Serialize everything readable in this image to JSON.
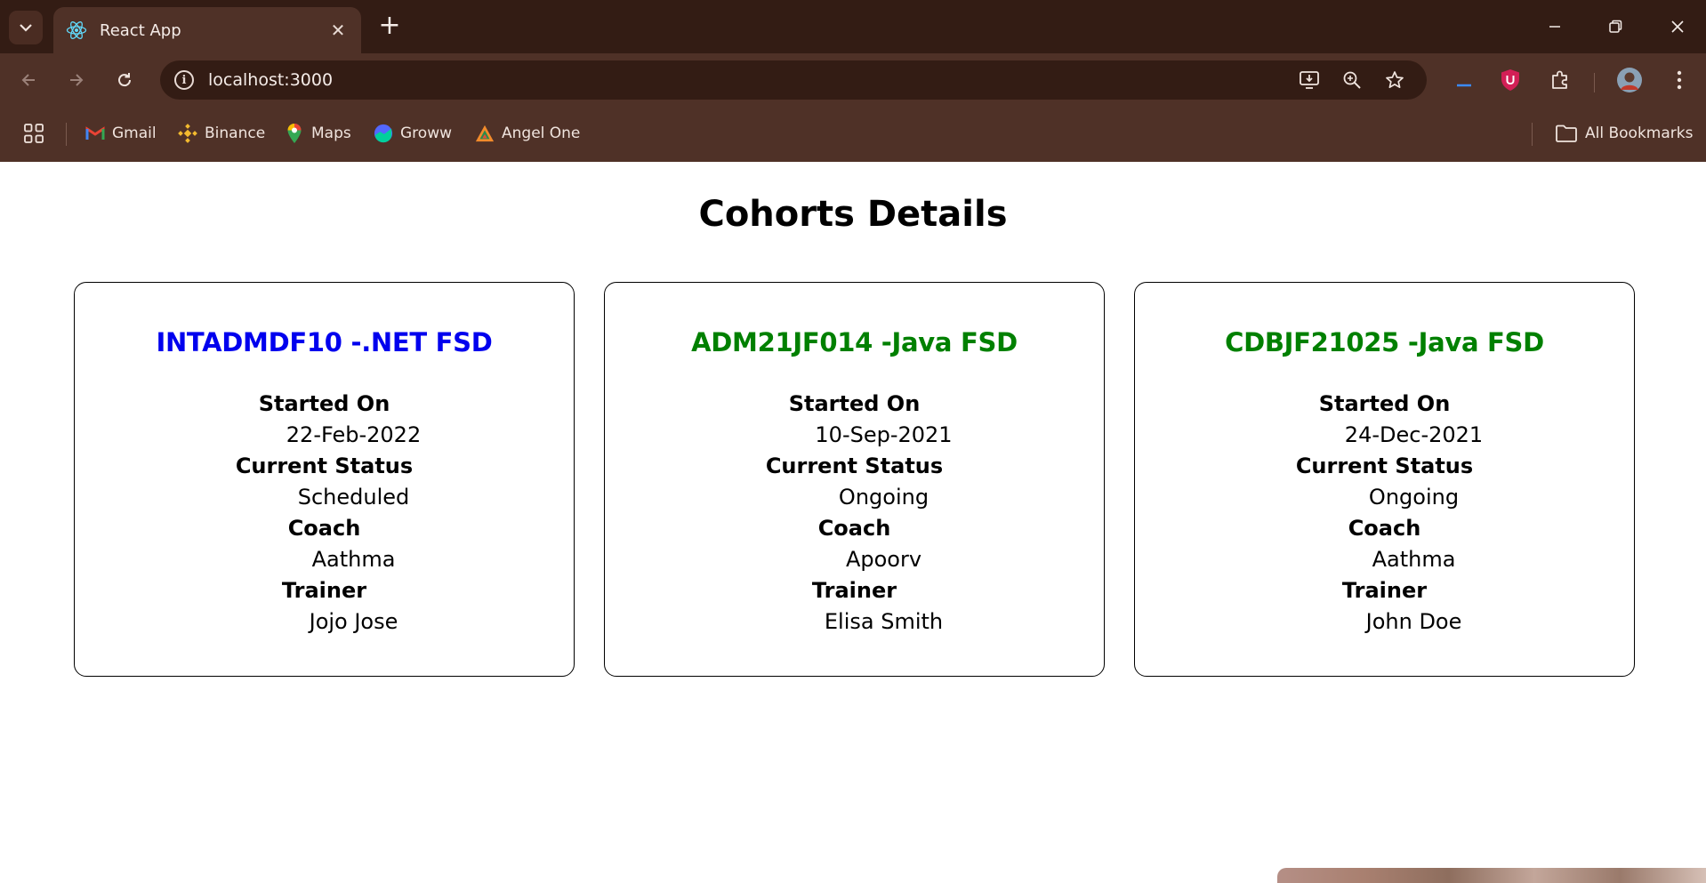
{
  "browser": {
    "tab": {
      "title": "React App"
    },
    "address_bar": {
      "url": "localhost:3000"
    },
    "bookmarks": [
      {
        "label": "Gmail",
        "icon": "gmail-icon"
      },
      {
        "label": "Binance",
        "icon": "binance-icon"
      },
      {
        "label": "Maps",
        "icon": "maps-icon"
      },
      {
        "label": "Groww",
        "icon": "groww-icon"
      },
      {
        "label": "Angel One",
        "icon": "angel-one-icon"
      }
    ],
    "all_bookmarks_label": "All Bookmarks",
    "colors": {
      "chrome_dark": "#331c14",
      "chrome": "#4f3127"
    }
  },
  "page": {
    "title": "Cohorts Details",
    "labels": {
      "started_on": "Started On",
      "current_status": "Current Status",
      "coach": "Coach",
      "trainer": "Trainer"
    },
    "cohorts": [
      {
        "code_title": "INTADMDF10 -.NET FSD",
        "title_color": "#0000ee",
        "started_on": "22-Feb-2022",
        "current_status": "Scheduled",
        "coach": "Aathma",
        "trainer": "Jojo Jose"
      },
      {
        "code_title": "ADM21JF014 -Java FSD",
        "title_color": "#008000",
        "started_on": "10-Sep-2021",
        "current_status": "Ongoing",
        "coach": "Apoorv",
        "trainer": "Elisa Smith"
      },
      {
        "code_title": "CDBJF21025 -Java FSD",
        "title_color": "#008000",
        "started_on": "24-Dec-2021",
        "current_status": "Ongoing",
        "coach": "Aathma",
        "trainer": "John Doe"
      }
    ]
  }
}
